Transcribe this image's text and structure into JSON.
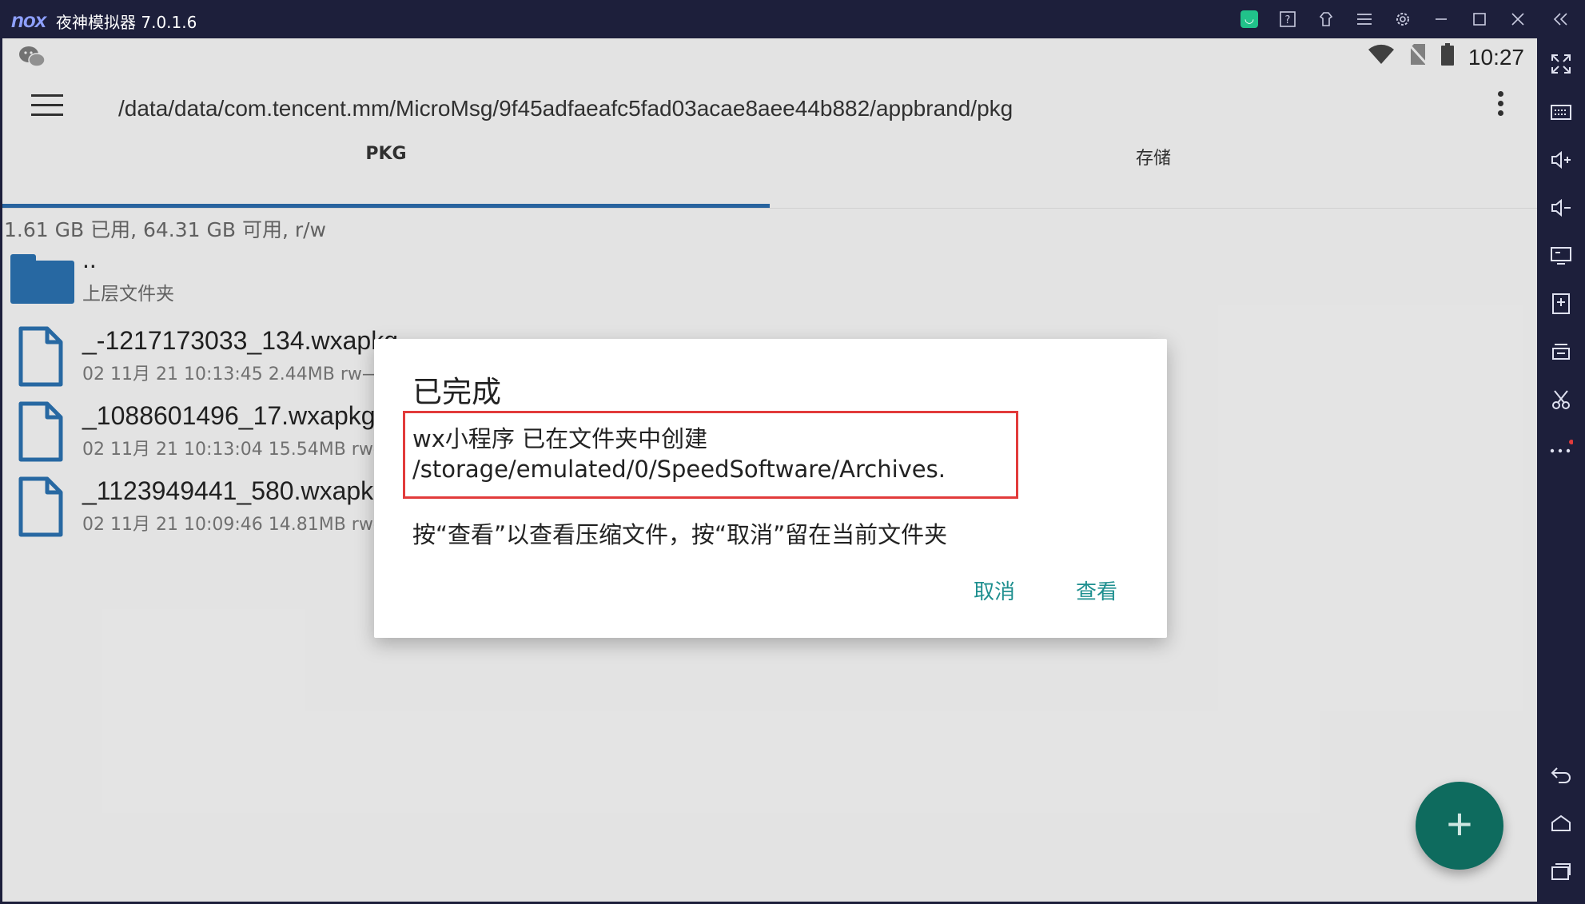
{
  "window": {
    "logo": "nox",
    "title": "夜神模拟器 7.0.1.6",
    "toolbar_icons": [
      "store-icon",
      "help-icon",
      "skin-icon",
      "menu-icon",
      "settings-icon",
      "minimize-icon",
      "maximize-icon",
      "close-icon",
      "collapse-icon"
    ]
  },
  "sidebar": {
    "icons": [
      "fullscreen-icon",
      "keyboard-icon",
      "volume-up-icon",
      "volume-down-icon",
      "screen-icon",
      "apk-install-icon",
      "multi-instance-icon",
      "screenshot-icon",
      "more-icon",
      "back-icon",
      "home-icon",
      "recent-apps-icon"
    ]
  },
  "status_bar": {
    "time": "10:27"
  },
  "app_bar": {
    "path": "/data/data/com.tencent.mm/MicroMsg/9f45adfaeafc5fad03acae8aee44b882/appbrand/pkg"
  },
  "tabs": [
    {
      "label": "PKG",
      "active": true
    },
    {
      "label": "存储",
      "active": false
    }
  ],
  "disk_info": "1.61 GB 已用, 64.31 GB 可用, r/w",
  "parent_folder": {
    "name": "..",
    "label": "上层文件夹"
  },
  "files": [
    {
      "name": "_-1217173033_134.wxapkg",
      "meta": "02 11月 21 10:13:45   2.44MB   rw—"
    },
    {
      "name": "_1088601496_17.wxapkg",
      "meta": "02 11月 21 10:13:04   15.54MB   rw-"
    },
    {
      "name": "_1123949441_580.wxapkg",
      "meta": "02 11月 21 10:09:46   14.81MB   rw-"
    }
  ],
  "dialog": {
    "title": "已完成",
    "message": "wx小程序 已在文件夹中创建 /storage/emulated/0/SpeedSoftware/Archives.",
    "hint": "按“查看”以查看压缩文件，按“取消”留在当前文件夹",
    "cancel_label": "取消",
    "view_label": "查看"
  },
  "fab": {
    "label": "+"
  },
  "colors": {
    "accent": "#1e8f8f",
    "tab_indicator": "#2b6aa8",
    "folder": "#2a6fad",
    "highlight_border": "#e23b3b",
    "fab": "#0e6b5e"
  }
}
